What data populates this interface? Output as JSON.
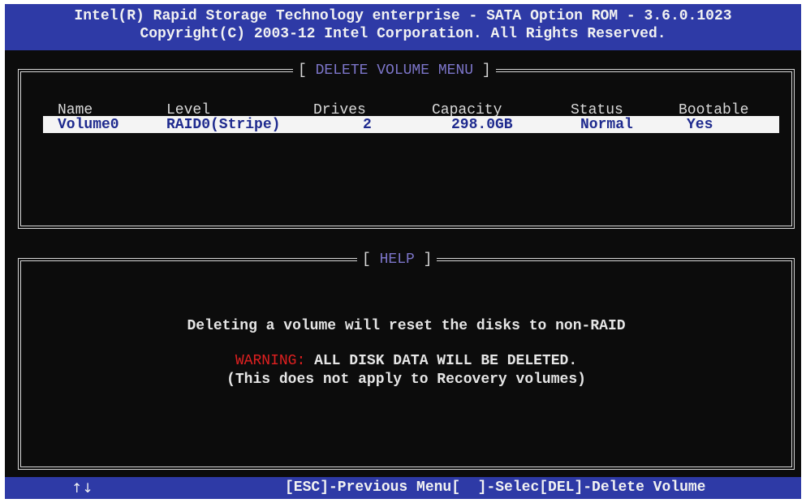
{
  "header": {
    "line1": "Intel(R) Rapid Storage Technology enterprise - SATA Option ROM - 3.6.0.1023",
    "line2": "Copyright(C) 2003-12 Intel Corporation.  All Rights Reserved."
  },
  "volume_panel": {
    "title_open": "[ ",
    "title": "DELETE VOLUME MENU",
    "title_close": " ]",
    "columns": [
      "Name",
      "Level",
      "Drives",
      "Capacity",
      "Status",
      "Bootable"
    ],
    "rows": [
      {
        "name": "Volume0",
        "level": "RAID0(Stripe)",
        "drives": "2",
        "capacity": "298.0GB",
        "status": "Normal",
        "bootable": "Yes"
      }
    ]
  },
  "help_panel": {
    "title_open": "[ ",
    "title": "HELP",
    "title_close": " ]",
    "line1": "Deleting a volume will reset the disks to non-RAID",
    "warning_label": "WARNING:",
    "warning_text": " ALL DISK DATA WILL BE DELETED.",
    "line3": "(This does not apply to Recovery volumes)"
  },
  "footer": {
    "arrows": "↑↓",
    "keys": "[ESC]-Previous Menu[  ]-Selec[DEL]-Delete Volume"
  },
  "colors": {
    "bar_blue": "#2e3aa6",
    "screen_bg": "#0c0c0c",
    "title_purple": "#7c75c9",
    "selected_row_text": "#1e2a8e",
    "warning_red": "#e02020"
  }
}
